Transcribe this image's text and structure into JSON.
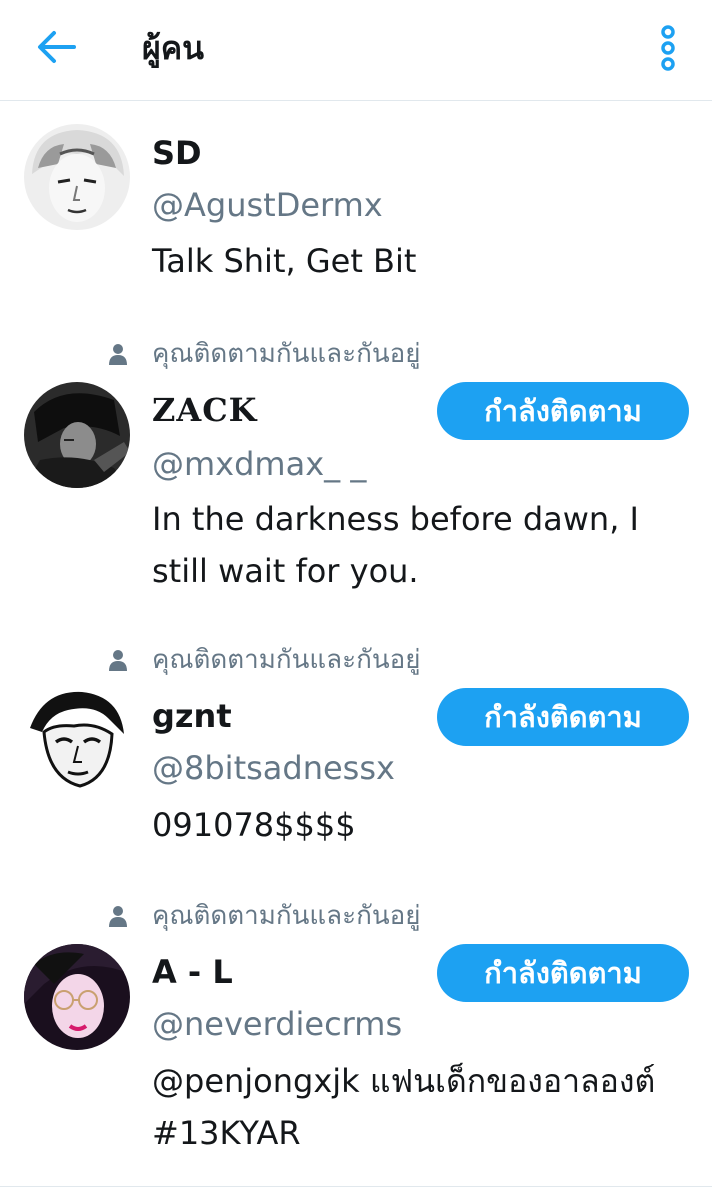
{
  "header": {
    "title": "ผู้คน",
    "back_icon": "arrow-left-icon",
    "menu_icon": "vertical-dots-icon",
    "accent": "#1da1f2"
  },
  "colors": {
    "accent": "#1da1f2",
    "secondary_text": "#657786",
    "divider": "#e1e8ed"
  },
  "users": [
    {
      "context": "",
      "name": "SD",
      "handle": "@AgustDermx",
      "bio": "Talk Shit, Get Bit",
      "button": ""
    },
    {
      "context": "คุณติดตามกันและกันอยู่",
      "name": "ZACK",
      "handle": "@mxdmax_ _",
      "bio": "In the darkness before dawn, I still wait for you.",
      "button": "กำลังติดตาม"
    },
    {
      "context": "คุณติดตามกันและกันอยู่",
      "name": "gznt",
      "handle": "@8bitsadnessx",
      "bio": "091078$$$$",
      "button": "กำลังติดตาม"
    },
    {
      "context": "คุณติดตามกันและกันอยู่",
      "name": "A - L",
      "handle": "@neverdiecrms",
      "bio": "@penjongxjk แฟนเด็กของอาลองต์ #13KYAR",
      "button": "กำลังติดตาม"
    }
  ]
}
